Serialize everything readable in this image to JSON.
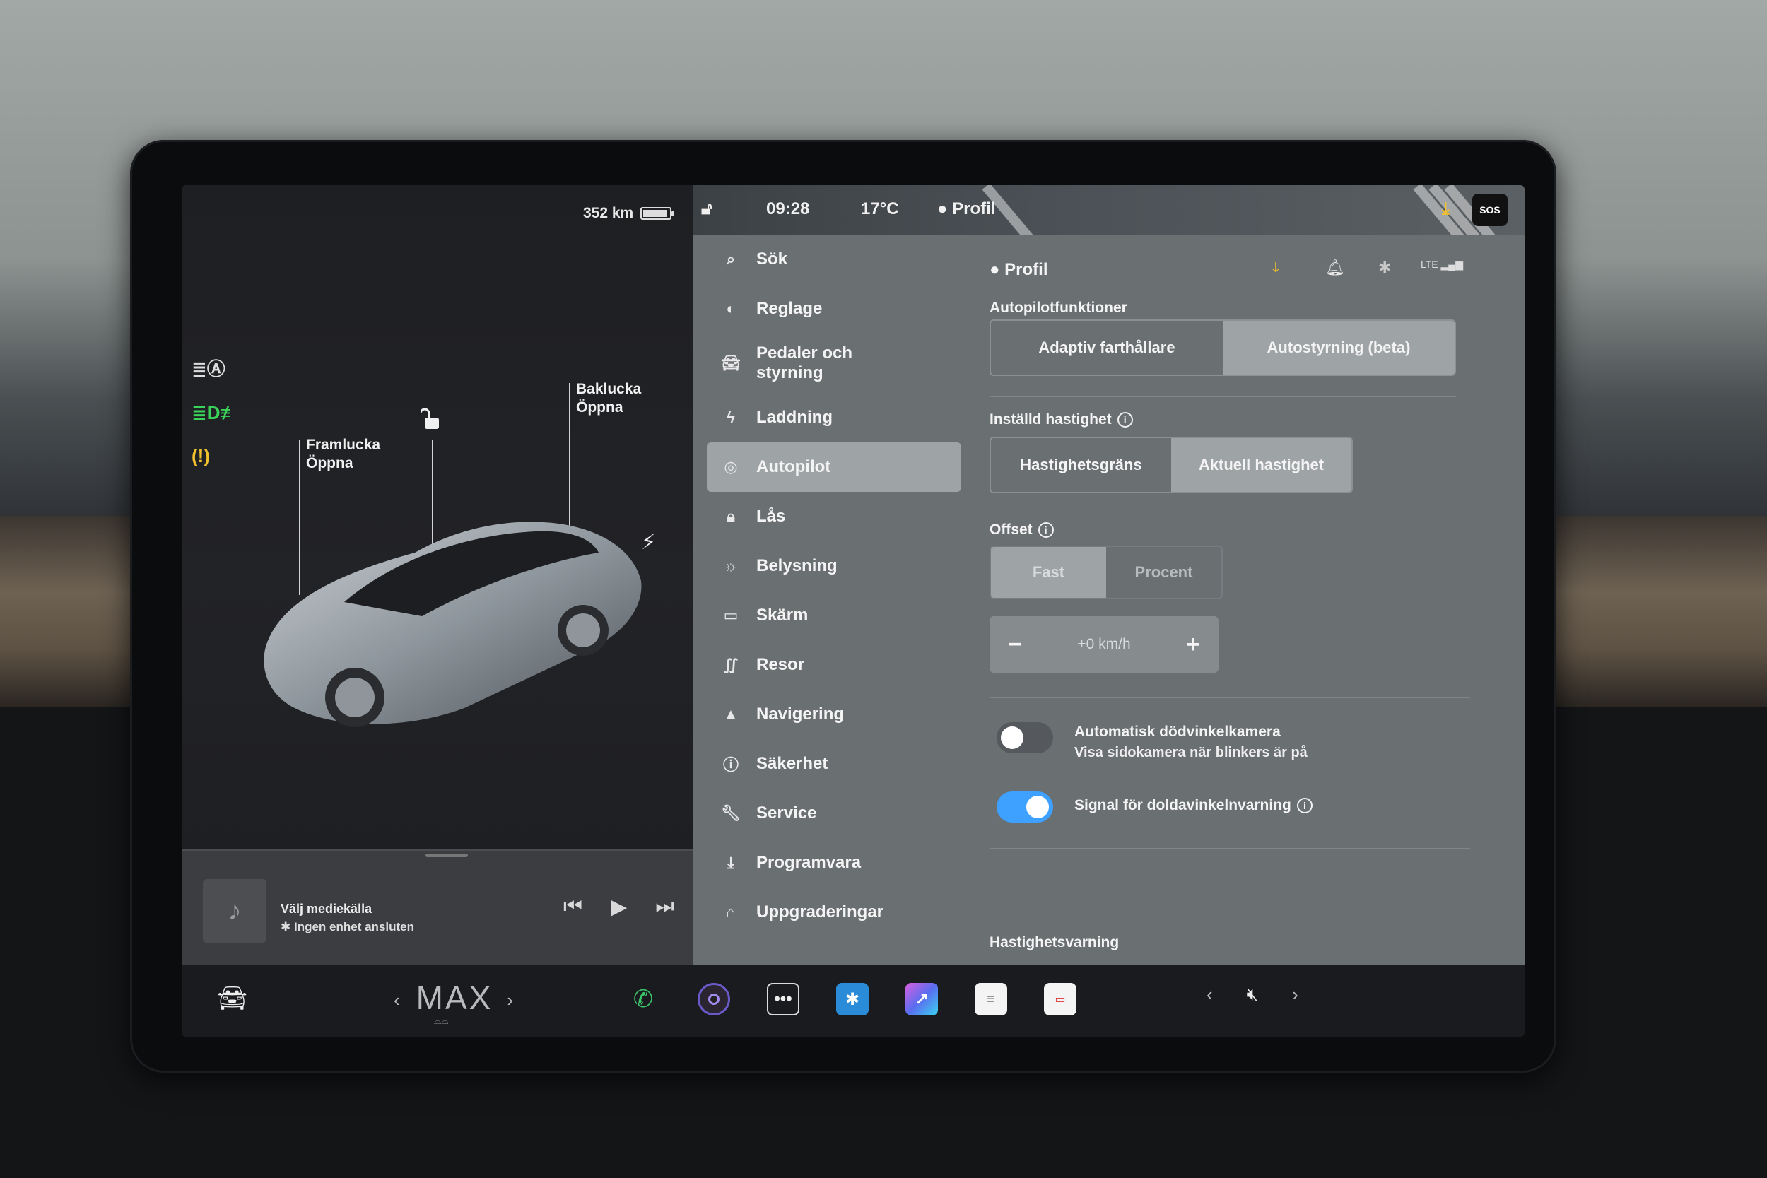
{
  "vehicle": {
    "range": "352 km",
    "battery_fraction": 0.85,
    "frunk_title": "Framlucka",
    "frunk_action": "Öppna",
    "trunk_title": "Baklucka",
    "trunk_action": "Öppna"
  },
  "status_bar": {
    "time": "09:28",
    "temperature": "17°C",
    "profile": "Profil",
    "sos": "SOS"
  },
  "menu": {
    "items": [
      {
        "label": "Sök",
        "icon": "search-icon"
      },
      {
        "label": "Reglage",
        "icon": "toggle-icon"
      },
      {
        "label": "Pedaler och styrning",
        "icon": "car-icon"
      },
      {
        "label": "Laddning",
        "icon": "bolt-icon"
      },
      {
        "label": "Autopilot",
        "icon": "steering-wheel-icon",
        "active": true
      },
      {
        "label": "Lås",
        "icon": "lock-icon"
      },
      {
        "label": "Belysning",
        "icon": "sun-icon"
      },
      {
        "label": "Skärm",
        "icon": "display-icon"
      },
      {
        "label": "Resor",
        "icon": "trips-icon"
      },
      {
        "label": "Navigering",
        "icon": "navigation-icon"
      },
      {
        "label": "Säkerhet",
        "icon": "safety-icon"
      },
      {
        "label": "Service",
        "icon": "wrench-icon"
      },
      {
        "label": "Programvara",
        "icon": "download-icon"
      },
      {
        "label": "Uppgraderingar",
        "icon": "bag-icon"
      }
    ]
  },
  "content": {
    "profile": "Profil",
    "status_icons": [
      "download-icon",
      "bell-icon",
      "bluetooth-icon",
      "lte-signal-icon"
    ],
    "lte_label": "LTE",
    "autopilot": {
      "title": "Autopilotfunktioner",
      "options": [
        "Adaptiv farthållare",
        "Autostyrning (beta)"
      ],
      "selected": 1
    },
    "set_speed": {
      "title": "Inställd hastighet",
      "options": [
        "Hastighetsgräns",
        "Aktuell hastighet"
      ],
      "selected": 1
    },
    "offset": {
      "title": "Offset",
      "options": [
        "Fast",
        "Procent"
      ],
      "selected": 0,
      "value": "+0 km/h",
      "minus": "−",
      "plus": "+"
    },
    "blind_spot_camera": {
      "title": "Automatisk dödvinkelkamera",
      "subtitle": "Visa sidokamera när blinkers är på",
      "enabled": false
    },
    "blind_spot_signal": {
      "title": "Signal för doldavinkelnvarning",
      "enabled": true
    },
    "next_section": "Hastighetsvarning"
  },
  "media": {
    "title": "Välj mediekälla",
    "subtitle": "Ingen enhet ansluten"
  },
  "dock": {
    "climate": "MAX",
    "apps": [
      "phone-icon",
      "camera-icon",
      "more-icon",
      "bluetooth-app-icon",
      "toybox-icon",
      "notepad-icon",
      "calendar-icon"
    ]
  },
  "colors": {
    "accent_blue": "#3ea0ff",
    "warning_yellow": "#f2c12e",
    "light_green": "#3ad45a",
    "phone_green": "#3cc46a"
  }
}
